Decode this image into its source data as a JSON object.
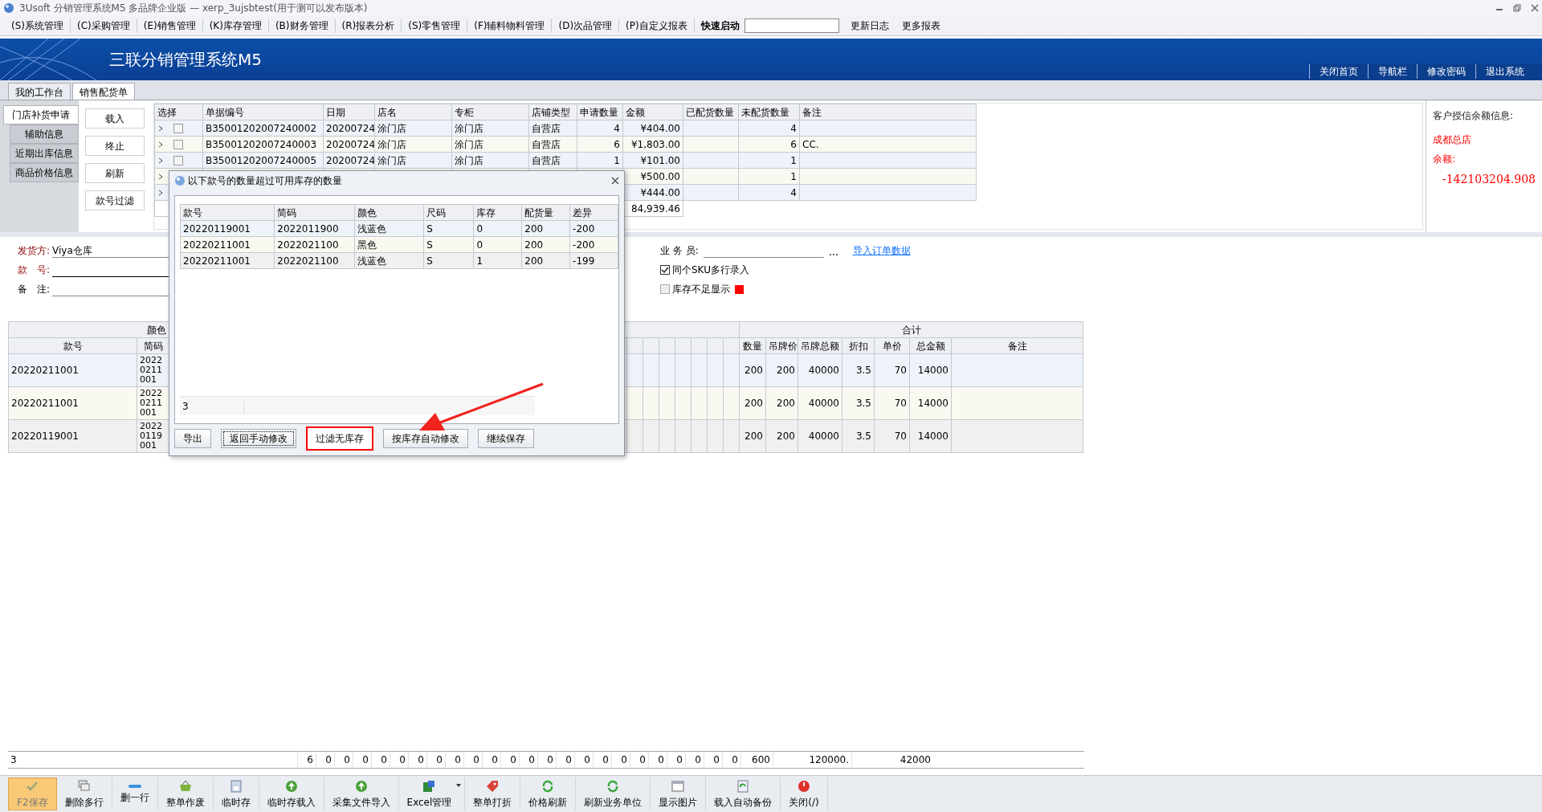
{
  "window": {
    "title": "3Usoft 分销管理系统M5 多品牌企业版 — xerp_3ujsbtest(用于测可以发布版本)"
  },
  "menu": [
    "(S)系统管理",
    "(C)采购管理",
    "(E)销售管理",
    "(K)库存管理",
    "(B)财务管理",
    "(R)报表分析",
    "(S)零售管理",
    "(F)辅料物料管理",
    "(D)次品管理",
    "(P)自定义报表"
  ],
  "quick_launch": {
    "label": "快速启动"
  },
  "menu_extra": [
    "更新日志",
    "更多报表"
  ],
  "banner": {
    "title": "三联分销管理系统M5",
    "links": [
      "关闭首页",
      "导航栏",
      "修改密码",
      "退出系统"
    ]
  },
  "doc_tabs": [
    {
      "label": "我的工作台",
      "selected": false
    },
    {
      "label": "销售配货单",
      "selected": true
    }
  ],
  "side_tabs": [
    {
      "label": "门店补货申请",
      "selected": true
    },
    {
      "label": "辅助信息",
      "selected": false
    },
    {
      "label": "近期出库信息",
      "selected": false
    },
    {
      "label": "商品价格信息",
      "selected": false
    }
  ],
  "action_buttons": [
    "载入",
    "终止",
    "刷新",
    "款号过滤"
  ],
  "requests": {
    "columns": [
      "选择",
      "单据编号",
      "日期",
      "店名",
      "专柜",
      "店铺类型",
      "申请数量",
      "金额",
      "已配货数量",
      "未配货数量",
      "备注"
    ],
    "rows": [
      {
        "checked": false,
        "cells": [
          "",
          "B35001202007240002",
          "20200724",
          "涂门店",
          "涂门店",
          "自营店",
          "4",
          "¥404.00",
          "",
          "4",
          ""
        ]
      },
      {
        "checked": false,
        "cells": [
          "",
          "B35001202007240003",
          "20200724",
          "涂门店",
          "涂门店",
          "自营店",
          "6",
          "¥1,803.00",
          "",
          "6",
          "CC."
        ]
      },
      {
        "checked": false,
        "cells": [
          "",
          "B35001202007240005",
          "20200724",
          "涂门店",
          "涂门店",
          "自营店",
          "1",
          "¥101.00",
          "",
          "1",
          ""
        ]
      },
      {
        "cells": [
          "",
          "",
          "",
          "",
          "",
          "",
          "",
          "¥500.00",
          "",
          "1",
          ""
        ]
      },
      {
        "cells": [
          "",
          "",
          "",
          "",
          "",
          "",
          "",
          "¥444.00",
          "",
          "4",
          ""
        ]
      }
    ],
    "total": "84,939.46"
  },
  "credit": {
    "title": "客户授信余额信息:",
    "customer": "成都总店",
    "balance_label": "余额:",
    "balance": "-142103204.908"
  },
  "form": {
    "shipper_label": "发货方:",
    "shipper": "Viya仓库",
    "style_label": "款　号:",
    "note_label": "备　注:",
    "salesman_label": "业 务 员:",
    "import_link": "导入订单数据",
    "checks": [
      {
        "label": "同个SKU多行录入",
        "checked": true
      },
      {
        "label": "库存不足显示",
        "checked": false,
        "color": "#ff0000"
      }
    ]
  },
  "grid": {
    "group_left": "颜色",
    "group_right": "合计",
    "columns": [
      "款号",
      "简码",
      "数量",
      "吊牌价",
      "吊牌总额",
      "折扣",
      "单价",
      "总金额",
      "备注"
    ],
    "rows": [
      [
        "20220211001",
        "20220211001",
        "200",
        "200",
        "40000",
        "3.5",
        "70",
        "14000"
      ],
      [
        "20220211001",
        "20220211001",
        "200",
        "200",
        "40000",
        "3.5",
        "70",
        "14000"
      ],
      [
        "20220119001",
        "20220119001",
        "200",
        "200",
        "40000",
        "3.5",
        "70",
        "14000"
      ]
    ],
    "footer_count": "3",
    "footer_values": [
      "6",
      "0",
      "0",
      "0",
      "0",
      "0",
      "0",
      "0",
      "0",
      "0",
      "0",
      "0",
      "0",
      "0",
      "0",
      "0",
      "0",
      "0",
      "0",
      "0",
      "0",
      "0",
      "0",
      "0"
    ],
    "footer_totals": [
      "600",
      "120000.",
      "42000"
    ]
  },
  "dialog": {
    "title": "以下款号的数量超过可用库存的数量",
    "columns": [
      "款号",
      "简码",
      "颜色",
      "尺码",
      "库存",
      "配货量",
      "差异"
    ],
    "rows": [
      [
        "20220119001",
        "2022011900",
        "浅蓝色",
        "S",
        "0",
        "200",
        "-200"
      ],
      [
        "20220211001",
        "2022021100",
        "黑色",
        "S",
        "0",
        "200",
        "-200"
      ],
      [
        "20220211001",
        "2022021100",
        "浅蓝色",
        "S",
        "1",
        "200",
        "-199"
      ]
    ],
    "count": "3",
    "buttons": [
      {
        "label": "导出",
        "focused": false,
        "highlighted": false
      },
      {
        "label": "返回手动修改",
        "focused": true,
        "highlighted": false
      },
      {
        "label": "过滤无库存",
        "focused": false,
        "highlighted": true
      },
      {
        "label": "按库存自动修改",
        "focused": false,
        "highlighted": false
      },
      {
        "label": "继续保存",
        "focused": false,
        "highlighted": false
      }
    ]
  },
  "toolbar": [
    {
      "label": "F2保存",
      "kind": "check",
      "active": true
    },
    {
      "label": "删除多行",
      "kind": "stack",
      "active": false
    },
    {
      "label": "删一行",
      "kind": "minus",
      "active": false
    },
    {
      "label": "整单作废",
      "kind": "basket",
      "active": false
    },
    {
      "label": "临时存",
      "kind": "disk",
      "active": false
    },
    {
      "label": "临时存载入",
      "kind": "up",
      "active": false
    },
    {
      "label": "采集文件导入",
      "kind": "up",
      "active": false
    },
    {
      "label": "Excel管理",
      "kind": "excel",
      "active": false
    },
    {
      "label": "整单打折",
      "kind": "tag",
      "active": false
    },
    {
      "label": "价格刷新",
      "kind": "refresh",
      "active": false
    },
    {
      "label": "刷新业务单位",
      "kind": "refresh",
      "active": false
    },
    {
      "label": "显示图片",
      "kind": "picture",
      "active": false
    },
    {
      "label": "载入自动备份",
      "kind": "doc",
      "active": false
    },
    {
      "label": "关闭(/)",
      "kind": "power",
      "active": false
    }
  ]
}
